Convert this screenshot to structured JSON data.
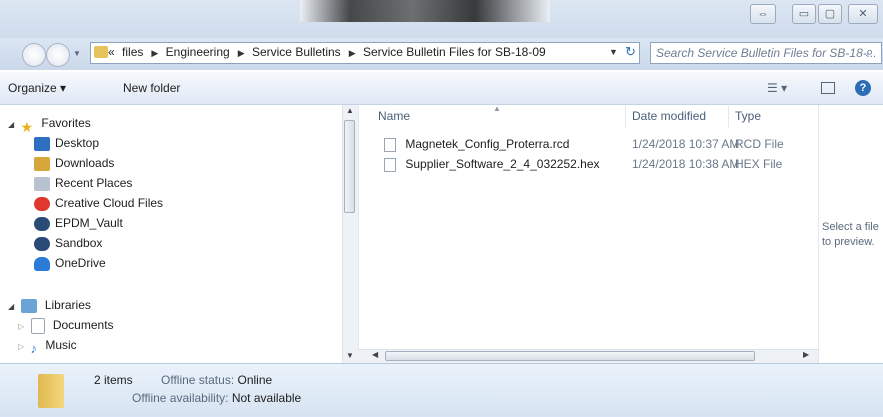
{
  "window": {
    "controls": {
      "restore": "⇔",
      "minimize": "▭",
      "maximize": "▢",
      "close": "✕"
    }
  },
  "address": {
    "overflow": "«",
    "crumbs": [
      "files",
      "Engineering",
      "Service Bulletins",
      "Service Bulletin Files for SB-18-09"
    ],
    "search_placeholder": "Search Service Bulletin Files for SB-18-..."
  },
  "toolbar": {
    "organize": "Organize ▾",
    "new_folder": "New folder"
  },
  "nav": {
    "favorites": "Favorites",
    "favorites_items": [
      "Desktop",
      "Downloads",
      "Recent Places",
      "Creative Cloud Files",
      "EPDM_Vault",
      "Sandbox",
      "OneDrive"
    ],
    "libraries": "Libraries",
    "libraries_items": [
      "Documents",
      "Music"
    ]
  },
  "columns": {
    "name": "Name",
    "date": "Date modified",
    "type": "Type"
  },
  "files": [
    {
      "name": "Magnetek_Config_Proterra.rcd",
      "date": "1/24/2018 10:37 AM",
      "type": "RCD File"
    },
    {
      "name": "Supplier_Software_2_4_032252.hex",
      "date": "1/24/2018 10:38 AM",
      "type": "HEX File"
    }
  ],
  "preview": {
    "line1": "Select a file",
    "line2": "to preview."
  },
  "status": {
    "count": "2 items",
    "offline_label": "Offline status:",
    "offline_value": "Online",
    "availability_label": "Offline availability:",
    "availability_value": "Not available"
  },
  "colors": {
    "accent": "#cfdcec",
    "folder": "#e8c25a",
    "link": "#1e5aa8"
  }
}
